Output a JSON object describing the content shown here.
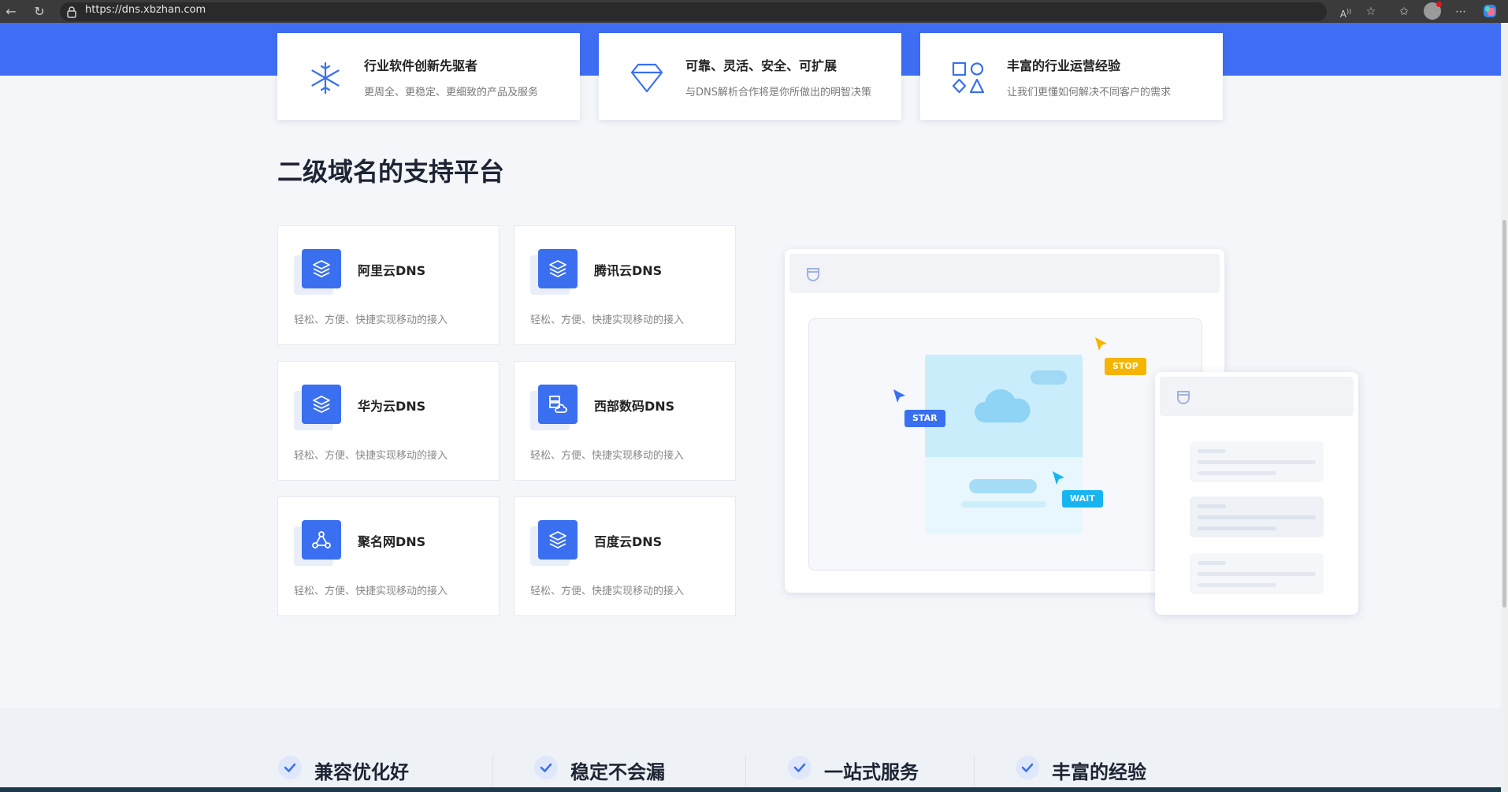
{
  "browser": {
    "url": "https://dns.xbzhan.com"
  },
  "features": [
    {
      "title": "行业软件创新先驱者",
      "desc": "更周全、更稳定、更细致的产品及服务",
      "icon": "snowflake-icon"
    },
    {
      "title": "可靠、灵活、安全、可扩展",
      "desc": "与DNS解析合作将是你所做出的明智决策",
      "icon": "diamond-icon"
    },
    {
      "title": "丰富的行业运营经验",
      "desc": "让我们更懂如何解决不同客户的需求",
      "icon": "shapes-icon"
    }
  ],
  "section": {
    "title": "二级域名的支持平台"
  },
  "platforms": [
    {
      "name": "阿里云DNS",
      "desc": "轻松、方便、快捷实现移动的接入",
      "icon": "layers-icon"
    },
    {
      "name": "腾讯云DNS",
      "desc": "轻松、方便、快捷实现移动的接入",
      "icon": "layers-icon"
    },
    {
      "name": "华为云DNS",
      "desc": "轻松、方便、快捷实现移动的接入",
      "icon": "layers-icon"
    },
    {
      "name": "西部数码DNS",
      "desc": "轻松、方便、快捷实现移动的接入",
      "icon": "server-cloud-icon"
    },
    {
      "name": "聚名网DNS",
      "desc": "轻松、方便、快捷实现移动的接入",
      "icon": "network-nodes-icon"
    },
    {
      "name": "百度云DNS",
      "desc": "轻松、方便、快捷实现移动的接入",
      "icon": "layers-icon"
    }
  ],
  "illustration": {
    "tags": {
      "star": "STAR",
      "stop": "STOP",
      "wait": "WAIT"
    },
    "colors": {
      "star": "#3a6ff0",
      "stop": "#f5b400",
      "wait": "#18b4f0"
    }
  },
  "benefits": [
    {
      "label": "兼容优化好"
    },
    {
      "label": "稳定不会漏"
    },
    {
      "label": "一站式服务"
    },
    {
      "label": "丰富的经验"
    }
  ],
  "colors": {
    "brand": "#3f6ef5",
    "icon_bg": "#3a6ff0"
  }
}
